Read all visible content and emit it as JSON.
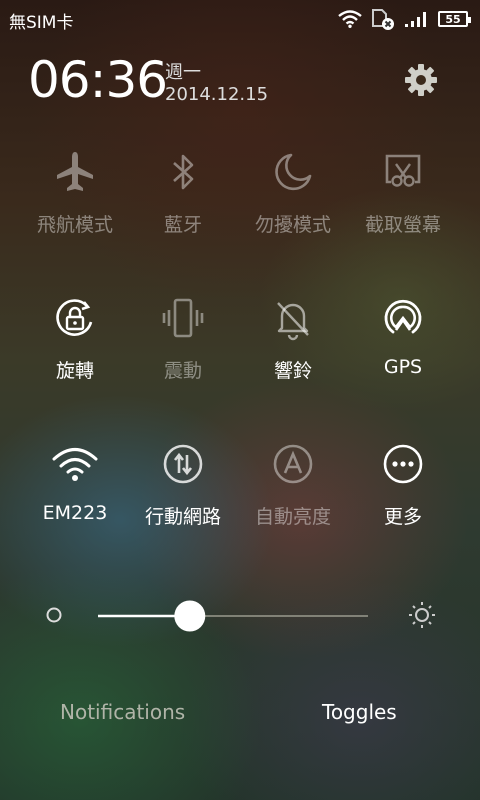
{
  "status_bar": {
    "carrier": "無SIM卡",
    "battery_level": "55"
  },
  "header": {
    "time": "06:36",
    "weekday": "週一",
    "date": "2014.12.15"
  },
  "toggles_row1": [
    {
      "label": "飛航模式",
      "icon": "airplane-icon",
      "active": false
    },
    {
      "label": "藍牙",
      "icon": "bluetooth-icon",
      "active": false
    },
    {
      "label": "勿擾模式",
      "icon": "moon-icon",
      "active": false
    },
    {
      "label": "截取螢幕",
      "icon": "screenshot-icon",
      "active": false
    }
  ],
  "toggles_row2": [
    {
      "label": "旋轉",
      "icon": "rotation-lock-icon",
      "active": true
    },
    {
      "label": "震動",
      "icon": "vibrate-icon",
      "active": false
    },
    {
      "label": "響鈴",
      "icon": "bell-off-icon",
      "active": true
    },
    {
      "label": "GPS",
      "icon": "gps-icon",
      "active": true
    }
  ],
  "toggles_row3": [
    {
      "label": "EM223",
      "icon": "wifi-icon",
      "active": true
    },
    {
      "label": "行動網路",
      "icon": "mobile-data-icon",
      "active": true
    },
    {
      "label": "自動亮度",
      "icon": "auto-brightness-icon",
      "active": false
    },
    {
      "label": "更多",
      "icon": "more-icon",
      "active": true
    }
  ],
  "brightness": {
    "level": 0.34
  },
  "tabs": {
    "notifications": "Notifications",
    "toggles": "Toggles",
    "active": "toggles"
  },
  "colors": {
    "active_text": "#ffffff",
    "inactive_tab": "#b0b4a8"
  }
}
